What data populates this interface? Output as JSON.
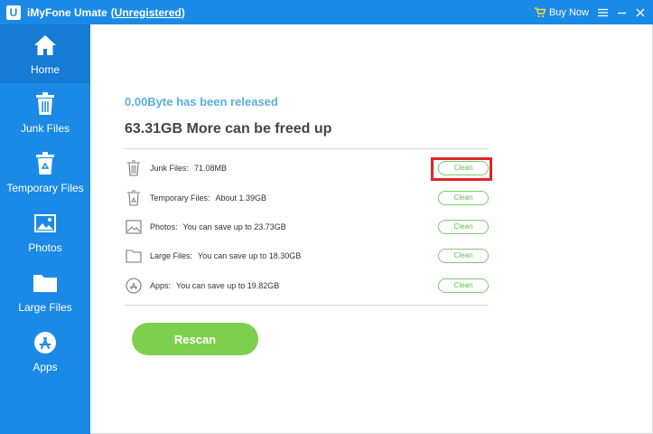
{
  "titlebar": {
    "logo_letter": "U",
    "app_name": "iMyFone Umate",
    "status": "(Unregistered)",
    "buy_now": "Buy Now",
    "icons": [
      "cart-icon",
      "menu-icon",
      "minimize-icon",
      "close-icon"
    ]
  },
  "sidebar": {
    "items": [
      {
        "label": "Home",
        "icon": "home-icon",
        "active": true
      },
      {
        "label": "Junk Files",
        "icon": "trash-icon",
        "active": false
      },
      {
        "label": "Temporary Files",
        "icon": "recycle-bin-icon",
        "active": false
      },
      {
        "label": "Photos",
        "icon": "photo-icon",
        "active": false
      },
      {
        "label": "Large Files",
        "icon": "folder-icon",
        "active": false
      },
      {
        "label": "Apps",
        "icon": "app-store-icon",
        "active": false
      }
    ]
  },
  "main": {
    "released": "0.00Byte has been released",
    "freed": "63.31GB More can be freed up",
    "rows": [
      {
        "label": "Junk Files:",
        "value": "71.08MB",
        "button": "Clean",
        "icon": "trash-icon"
      },
      {
        "label": "Temporary Files:",
        "value": "About 1.39GB",
        "button": "Clean",
        "icon": "recycle-bin-icon"
      },
      {
        "label": "Photos:",
        "value": "You can save up to 23.73GB",
        "button": "Clean",
        "icon": "photo-icon"
      },
      {
        "label": "Large Files:",
        "value": "You can save up to 18.30GB",
        "button": "Clean",
        "icon": "folder-icon"
      },
      {
        "label": "Apps:",
        "value": "You can save up to 19.82GB",
        "button": "Clean",
        "icon": "app-store-icon"
      }
    ],
    "rescan": "Rescan"
  },
  "colors": {
    "brand_blue": "#1a8ae6",
    "active_blue": "#157bd4",
    "green": "#7fcf4f",
    "highlight_red": "#e0242a"
  }
}
